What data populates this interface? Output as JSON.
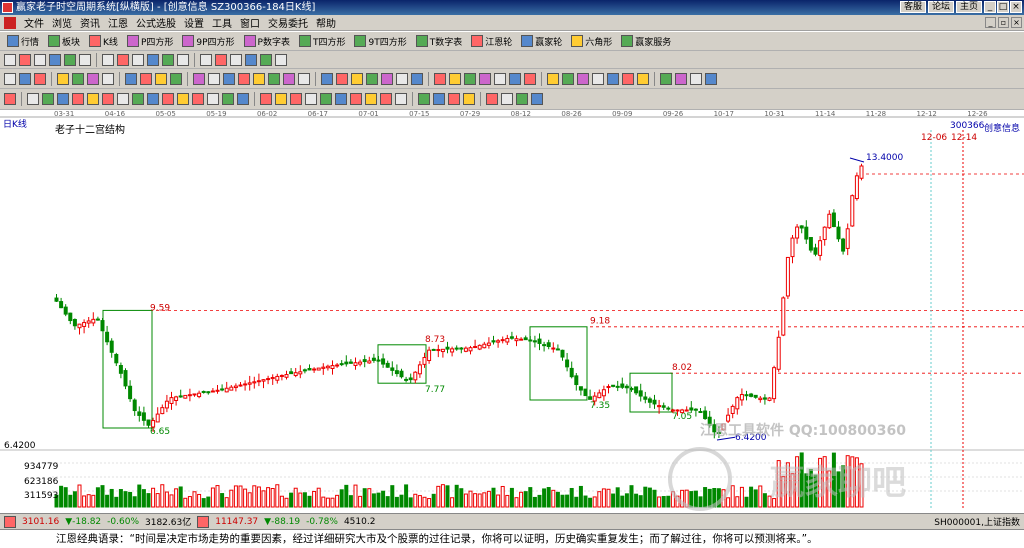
{
  "window": {
    "title": "赢家老子时空周期系统[纵横版] - [创意信息   SZ300366-184日K线]",
    "links": [
      "客服",
      "论坛",
      "主页"
    ]
  },
  "menu": [
    "文件",
    "浏览",
    "资讯",
    "江恩",
    "公式选股",
    "设置",
    "工具",
    "窗口",
    "交易委托",
    "帮助"
  ],
  "toolbar1": [
    {
      "icon": "quote-icon",
      "label": "行情"
    },
    {
      "icon": "sector-icon",
      "label": "板块"
    },
    {
      "icon": "kline-icon",
      "label": "K线"
    },
    {
      "icon": "p-square-icon",
      "label": "P四方形"
    },
    {
      "icon": "9p-square-icon",
      "label": "9P四方形"
    },
    {
      "icon": "pn-table-icon",
      "label": "P数字表"
    },
    {
      "icon": "t-square-icon",
      "label": "T四方形"
    },
    {
      "icon": "9t-square-icon",
      "label": "9T四方形"
    },
    {
      "icon": "tn-table-icon",
      "label": "T数字表"
    },
    {
      "icon": "gann-wheel-icon",
      "label": "江恩轮"
    },
    {
      "icon": "winner-wheel-icon",
      "label": "赢家轮"
    },
    {
      "icon": "hexagon-icon",
      "label": "六角形"
    },
    {
      "icon": "service-icon",
      "label": "赢家服务"
    }
  ],
  "chart_data": {
    "type": "candlestick",
    "period_label": "日K线",
    "title": "老子十二宫结构",
    "stock_code": "300366",
    "stock_name": "创意信息",
    "x_dates": [
      "03-31",
      "04-16",
      "05-05",
      "05-19",
      "06-02",
      "06-17",
      "07-01",
      "07-15",
      "07-29",
      "08-12",
      "08-26",
      "09-09",
      "09-26",
      "10-17",
      "10-31",
      "11-14",
      "11-28",
      "12-12",
      "12-26"
    ],
    "cycle_dates": [
      "12-06",
      "12-14"
    ],
    "price_labels": [
      "9.59",
      "6.65",
      "8.73",
      "7.77",
      "9.18",
      "7.35",
      "8.02",
      "7.05",
      "6.4200",
      "13.4000"
    ],
    "y_axis_price_label": "6.4200",
    "volume_axis": [
      "934779",
      "623186",
      "311593"
    ],
    "yrange": [
      6.2,
      13.8
    ]
  },
  "status": {
    "sh_index": "3101.16",
    "sh_change": "▼-18.82",
    "sh_pct": "-0.60%",
    "sh_amount": "3182.63亿",
    "sz_index": "11147.37",
    "sz_change": "▼-88.19",
    "sz_pct": "-0.78%",
    "sz_amount": "4510.2",
    "right": "SH000001,上证指数"
  },
  "quote": "江恩经典语录：“时间是决定市场走势的重要因素，经过详细研究大市及个股票的过往记录，你将可以证明，历史确实重复发生；而了解过往，你将可以预测将来。”。",
  "watermark": {
    "line1": "江恩工具软件  QQ:100800360",
    "line2": "赢家聊吧"
  },
  "colors": {
    "up": "#e00000",
    "down": "#008000",
    "box": "#008000",
    "dash_red": "#e00000"
  }
}
